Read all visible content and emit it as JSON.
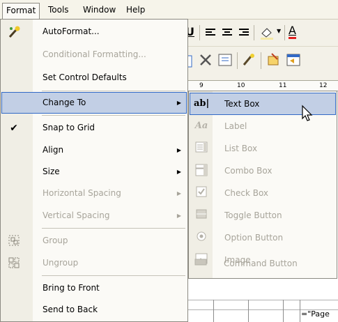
{
  "menubar": {
    "items": [
      {
        "label": "Format"
      },
      {
        "label": "Tools"
      },
      {
        "label": "Window"
      },
      {
        "label": "Help"
      }
    ]
  },
  "ruler": {
    "ticks": [
      "9",
      "10",
      "11",
      "12"
    ]
  },
  "background_text": "=\"Page",
  "format_menu": {
    "items": [
      {
        "label": "AutoFormat...",
        "icon": "autoformat-wand-icon"
      },
      {
        "label": "Conditional Formatting..."
      },
      {
        "label": "Set Control Defaults"
      },
      {
        "label": "Change To"
      },
      {
        "label": "Snap to Grid",
        "icon": "check-icon"
      },
      {
        "label": "Align"
      },
      {
        "label": "Size"
      },
      {
        "label": "Horizontal Spacing"
      },
      {
        "label": "Vertical Spacing"
      },
      {
        "label": "Group",
        "icon": "group-icon"
      },
      {
        "label": "Ungroup",
        "icon": "ungroup-icon"
      },
      {
        "label": "Bring to Front"
      },
      {
        "label": "Send to Back"
      }
    ]
  },
  "change_to_menu": {
    "items": [
      {
        "label": "Text Box",
        "icon": "textbox-icon",
        "icon_text": "ab|"
      },
      {
        "label": "Label",
        "icon": "label-icon",
        "icon_text": "Aa"
      },
      {
        "label": "List Box",
        "icon": "listbox-icon"
      },
      {
        "label": "Combo Box",
        "icon": "combobox-icon"
      },
      {
        "label": "Check Box",
        "icon": "checkbox-icon"
      },
      {
        "label": "Toggle Button",
        "icon": "toggle-button-icon"
      },
      {
        "label": "Option Button",
        "icon": "option-button-icon"
      },
      {
        "label": "Image",
        "icon": "image-icon"
      },
      {
        "label": "Command Button",
        "icon": "command-button-icon"
      }
    ]
  },
  "colors": {
    "highlight": "#c2cfe5",
    "highlight_border": "#3169c6",
    "disabled_text": "#a7a49a"
  }
}
